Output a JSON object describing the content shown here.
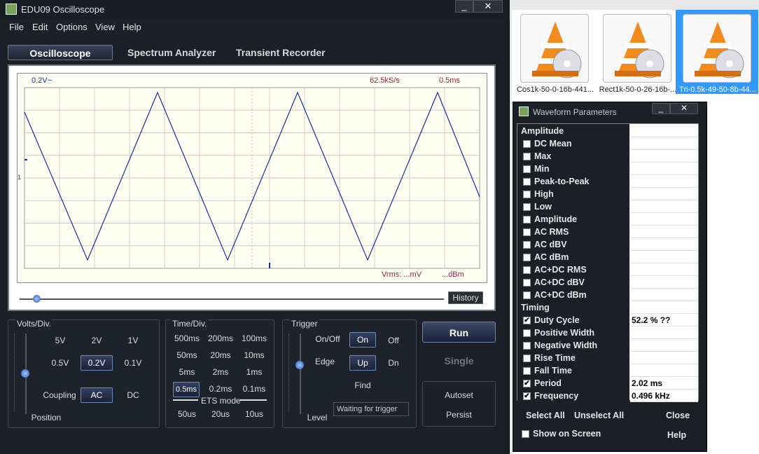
{
  "window": {
    "title": "EDU09 Oscilloscope",
    "minimize": "_",
    "close": "✕"
  },
  "menu": [
    "File",
    "Edit",
    "Options",
    "View",
    "Help"
  ],
  "tabs": [
    "Oscilloscope",
    "Spectrum Analyzer",
    "Transient Recorder"
  ],
  "scope": {
    "volts_readout": "0.2V~",
    "sample_rate": "62.5kS/s",
    "timebase": "0.5ms",
    "vrms": "Vrms: ...mV",
    "dbm": "...dBm",
    "marker": "1",
    "trace_color": "#1a2aa8"
  },
  "history_label": "History",
  "volts": {
    "title": "Volts/Div.",
    "options": [
      "5V",
      "2V",
      "1V",
      "0.5V",
      "0.2V",
      "0.1V"
    ],
    "selected": "0.2V",
    "coupling_label": "Coupling",
    "coupling_ac": "AC",
    "coupling_dc": "DC",
    "position_label": "Position"
  },
  "time": {
    "title": "Time/Div.",
    "row1": [
      "500ms",
      "200ms",
      "100ms"
    ],
    "row2": [
      "50ms",
      "20ms",
      "10ms"
    ],
    "row3": [
      "5ms",
      "2ms",
      "1ms"
    ],
    "row4": [
      "0.5ms",
      "0.2ms",
      "0.1ms"
    ],
    "row5": [
      "50us",
      "20us",
      "10us"
    ],
    "ets_label": "ETS mode",
    "selected": "0.5ms"
  },
  "trigger": {
    "title": "Trigger",
    "onoff_label": "On/Off",
    "on": "On",
    "off": "Off",
    "edge_label": "Edge",
    "up": "Up",
    "dn": "Dn",
    "find": "Find",
    "level_label": "Level",
    "status": "Waiting for trigger"
  },
  "buttons": {
    "run": "Run",
    "single": "Single",
    "autoset": "Autoset",
    "persist": "Persist"
  },
  "desktop_files": [
    {
      "caption": "Cos1k-50-0-16b-441..."
    },
    {
      "caption": "Rect1k-50-0-26-16b-..."
    },
    {
      "caption": "Tri-0.5k-49-50-8b-44..."
    }
  ],
  "waveform_params": {
    "title": "Waveform Parameters",
    "sections": {
      "amplitude": "Amplitude",
      "timing": "Timing"
    },
    "amplitude_rows": [
      {
        "label": "DC  Mean",
        "checked": false,
        "value": ""
      },
      {
        "label": "Max",
        "checked": false,
        "value": ""
      },
      {
        "label": "Min",
        "checked": false,
        "value": ""
      },
      {
        "label": "Peak-to-Peak",
        "checked": false,
        "value": ""
      },
      {
        "label": "High",
        "checked": false,
        "value": ""
      },
      {
        "label": "Low",
        "checked": false,
        "value": ""
      },
      {
        "label": "Amplitude",
        "checked": false,
        "value": ""
      },
      {
        "label": "AC RMS",
        "checked": false,
        "value": ""
      },
      {
        "label": "AC dBV",
        "checked": false,
        "value": ""
      },
      {
        "label": "AC dBm",
        "checked": false,
        "value": ""
      },
      {
        "label": "AC+DC RMS",
        "checked": false,
        "value": ""
      },
      {
        "label": "AC+DC dBV",
        "checked": false,
        "value": ""
      },
      {
        "label": "AC+DC dBm",
        "checked": false,
        "value": ""
      }
    ],
    "timing_rows": [
      {
        "label": "Duty Cycle",
        "checked": true,
        "value": "52.2 % ??"
      },
      {
        "label": "Positive Width",
        "checked": false,
        "value": ""
      },
      {
        "label": "Negative Width",
        "checked": false,
        "value": ""
      },
      {
        "label": "Rise Time",
        "checked": false,
        "value": ""
      },
      {
        "label": "Fall Time",
        "checked": false,
        "value": ""
      },
      {
        "label": "Period",
        "checked": true,
        "value": "2.02 ms"
      },
      {
        "label": "Frequency",
        "checked": true,
        "value": "0.496 kHz"
      }
    ],
    "select_all": "Select All",
    "unselect_all": "Unselect All",
    "close": "Close",
    "show_on_screen": "Show on Screen",
    "help": "Help"
  }
}
